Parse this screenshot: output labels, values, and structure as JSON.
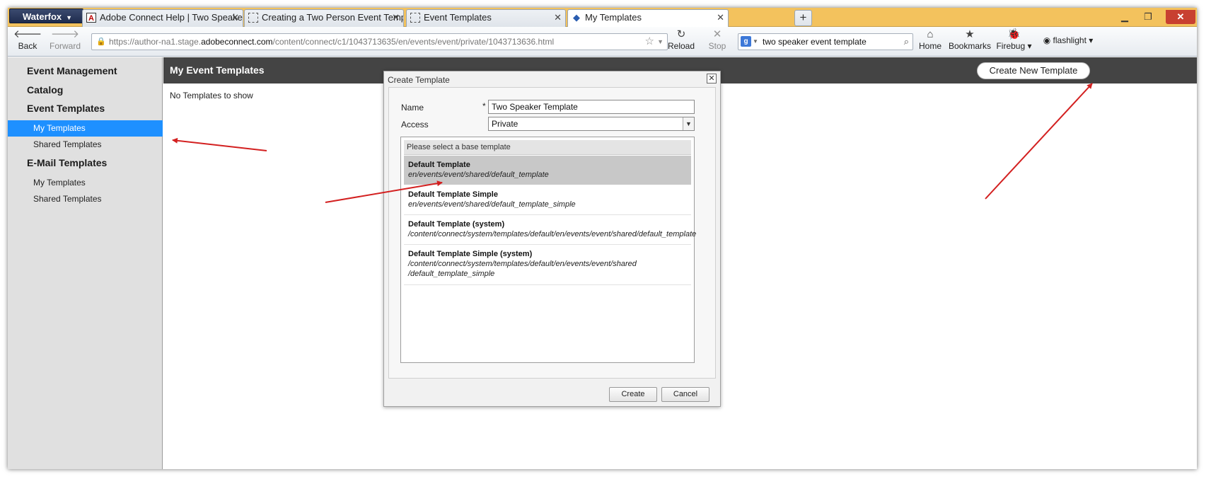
{
  "browser": {
    "app_menu": "Waterfox",
    "tabs": [
      {
        "title": "Adobe Connect Help | Two Speaker E...",
        "favicon": "adobe-icon"
      },
      {
        "title": "Creating a Two Person Event Templat...",
        "favicon": "blank-page-icon"
      },
      {
        "title": "Event Templates",
        "favicon": "blank-page-icon"
      },
      {
        "title": "My Templates",
        "favicon": "cube-icon",
        "active": true
      }
    ],
    "nav": {
      "back": "Back",
      "forward": "Forward",
      "reload": "Reload",
      "stop": "Stop",
      "home": "Home",
      "bookmarks": "Bookmarks",
      "firebug": "Firebug",
      "profile": "flashlight"
    },
    "url": {
      "prefix": "https://author-na1.stage.",
      "domain": "adobeconnect.com",
      "path": "/content/connect/c1/1043713635/en/events/event/private/1043713636.html"
    },
    "search": {
      "value": "two speaker event template"
    }
  },
  "sidebar": {
    "sections": [
      {
        "label": "Event Management"
      },
      {
        "label": "Catalog"
      },
      {
        "label": "Event Templates",
        "items": [
          {
            "label": "My Templates",
            "selected": true
          },
          {
            "label": "Shared Templates"
          }
        ]
      },
      {
        "label": "E-Mail Templates",
        "items": [
          {
            "label": "My Templates"
          },
          {
            "label": "Shared Templates"
          }
        ]
      }
    ]
  },
  "main": {
    "title": "My Event Templates",
    "create_button": "Create New Template",
    "empty_text": "No Templates to show"
  },
  "dialog": {
    "title": "Create Template",
    "close_glyph": "✕",
    "name_label": "Name",
    "required_mark": "*",
    "name_value": "Two Speaker Template",
    "access_label": "Access",
    "access_value": "Private",
    "list_header": "Please select a base template",
    "templates": [
      {
        "name": "Default Template",
        "path": "en/events/event/shared/default_template",
        "selected": true
      },
      {
        "name": "Default Template Simple",
        "path": "en/events/event/shared/default_template_simple"
      },
      {
        "name": "Default Template (system)",
        "path": "/content/connect/system/templates/default/en/events/event/shared/default_template"
      },
      {
        "name": "Default Template Simple (system)",
        "path": "/content/connect/system/templates/default/en/events/event/shared",
        "path2": "/default_template_simple"
      }
    ],
    "create_button": "Create",
    "cancel_button": "Cancel"
  },
  "colors": {
    "tabstrip": "#f3c25d",
    "selected_sidebar": "#1e90ff",
    "header_bar": "#444444",
    "annotation_arrow": "#d32020"
  }
}
